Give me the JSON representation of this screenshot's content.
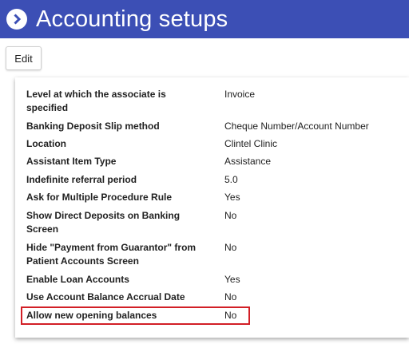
{
  "header": {
    "title": "Accounting setups",
    "icon": "chevron-right-circle-icon",
    "background": "#3c4fb5"
  },
  "toolbar": {
    "edit_label": "Edit"
  },
  "settings": {
    "rows": [
      {
        "label": "Level at which the associate is specified",
        "value": "Invoice"
      },
      {
        "label": "Banking Deposit Slip method",
        "value": "Cheque Number/Account Number"
      },
      {
        "label": "Location",
        "value": "Clintel Clinic"
      },
      {
        "label": "Assistant Item Type",
        "value": "Assistance"
      },
      {
        "label": "Indefinite referral period",
        "value": "5.0"
      },
      {
        "label": "Ask for Multiple Procedure Rule",
        "value": "Yes"
      },
      {
        "label": "Show Direct Deposits on Banking Screen",
        "value": "No"
      },
      {
        "label": "Hide \"Payment from Guarantor\" from Patient Accounts Screen",
        "value": "No"
      },
      {
        "label": "Enable Loan Accounts",
        "value": "Yes"
      },
      {
        "label": "Use Account Balance Accrual Date",
        "value": "No"
      },
      {
        "label": "Allow new opening balances",
        "value": "No"
      }
    ],
    "highlight_color": "#d21f26"
  }
}
